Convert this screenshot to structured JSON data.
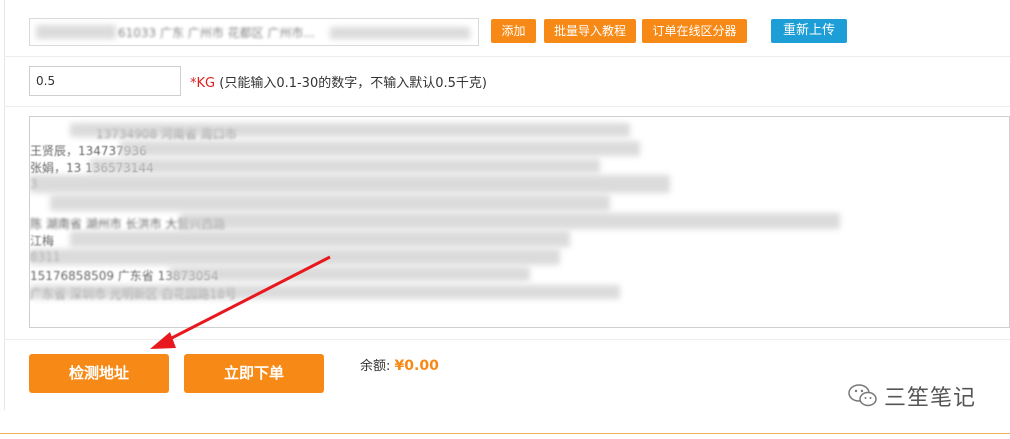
{
  "address_input": {
    "visible_fragment": "61033 广东 广州市 花都区 广州市..."
  },
  "buttons": {
    "add": "添加",
    "import_tutorial": "批量导入教程",
    "online_splitter": "订单在线区分器",
    "reupload": "重新上传",
    "check_address": "检测地址",
    "place_order": "立即下单"
  },
  "weight": {
    "value": "0.5",
    "unit_label": "*KG",
    "hint": " (只能输入0.1-30的数字，不输入默认0.5千克)"
  },
  "textarea_lines": [
    "13734908      河南省 周口市",
    "王贤辰，134737936",
    "张娟，13                                                                                                  136573144",
    "                                                                                                             3",
    "          陈                          湖南省 湖州市 长洪市 大营兴西路",
    "   江梅",
    "                                                                                                   8311",
    "      15176858509       广东省                                                   13873054",
    "                        广东省 深圳市 光明新区 白花园路18号"
  ],
  "balance": {
    "label": "余额:",
    "amount": "¥0.00"
  },
  "watermark": {
    "text": "三笙笔记"
  },
  "colors": {
    "orange": "#f78a16",
    "blue": "#1d9ed6",
    "red": "#e02020"
  }
}
